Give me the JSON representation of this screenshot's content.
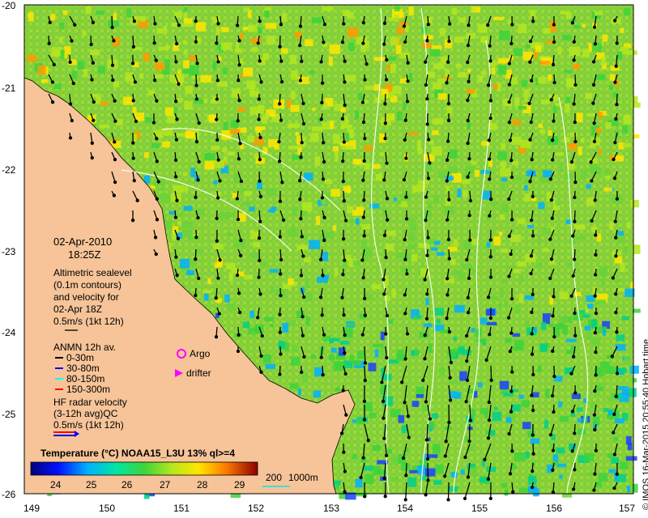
{
  "map": {
    "date": "02-Apr-2010",
    "time": "18:25Z",
    "altimetry_legend": [
      "Altimetric sealevel",
      "(0.1m contours)",
      "and velocity for",
      "02-Apr 18Z",
      "0.5m/s (1kt 12h)"
    ],
    "anmn_title": "ANMN 12h av.",
    "anmn_depths": [
      {
        "label": "0-30m",
        "color": "#000000"
      },
      {
        "label": "30-80m",
        "color": "#0000ff"
      },
      {
        "label": "80-150m",
        "color": "#00ffff"
      },
      {
        "label": "150-300m",
        "color": "#ff0000"
      }
    ],
    "argo_label": "Argo",
    "drifter_label": "drifter",
    "hf_radar_legend": [
      "HF radar velocity",
      "(3-12h avg)QC",
      "0.5m/s (1kt 12h)"
    ],
    "colorbar_title": "Temperature (°C) NOAA15_L3U 13% ql>=4",
    "colorbar_ticks": [
      "24",
      "25",
      "26",
      "27",
      "28",
      "29"
    ],
    "bathy_legend": {
      "shallow": "200",
      "deep": "1000m"
    },
    "y_ticks": [
      "-20",
      "-21",
      "-22",
      "-23",
      "-24",
      "-25",
      "-26"
    ],
    "x_ticks": [
      "149",
      "150",
      "151",
      "152",
      "153",
      "154",
      "155",
      "156",
      "157"
    ],
    "credit": "© IMOS 16-Mar-2015 20:55:40 Hobart time",
    "colors": {
      "land": "#f6c498",
      "contour": "#ffffff",
      "bathy_200": "#40e0d0"
    }
  }
}
